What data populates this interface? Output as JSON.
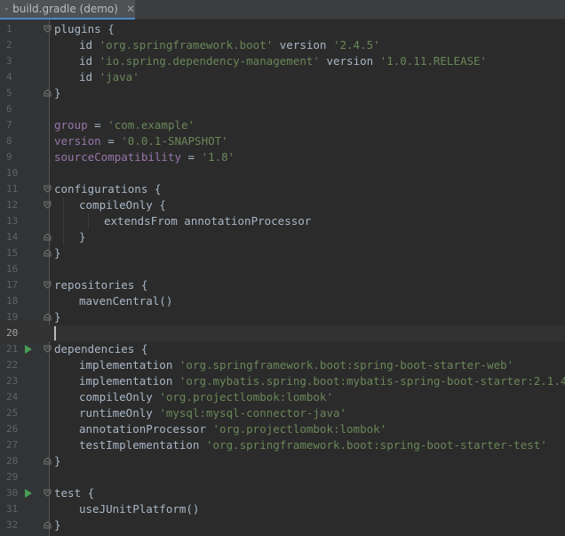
{
  "tab": {
    "title": "build.gradle (demo)",
    "close_glyph": "✕",
    "icon": "gradle-elephant-icon"
  },
  "editor": {
    "current_line": 20,
    "lines": [
      {
        "n": "1",
        "fold": "open",
        "run": false,
        "indent": 0,
        "tokens": [
          {
            "t": "plugins {",
            "c": "id"
          }
        ]
      },
      {
        "n": "2",
        "fold": "",
        "run": false,
        "indent": 1,
        "tokens": [
          {
            "t": "id ",
            "c": "id"
          },
          {
            "t": "'org.springframework.boot'",
            "c": "str"
          },
          {
            "t": " version ",
            "c": "id"
          },
          {
            "t": "'2.4.5'",
            "c": "str"
          }
        ]
      },
      {
        "n": "3",
        "fold": "",
        "run": false,
        "indent": 1,
        "tokens": [
          {
            "t": "id ",
            "c": "id"
          },
          {
            "t": "'io.spring.dependency-management'",
            "c": "str"
          },
          {
            "t": " version ",
            "c": "id"
          },
          {
            "t": "'1.0.11.RELEASE'",
            "c": "str"
          }
        ]
      },
      {
        "n": "4",
        "fold": "",
        "run": false,
        "indent": 1,
        "tokens": [
          {
            "t": "id ",
            "c": "id"
          },
          {
            "t": "'java'",
            "c": "str"
          }
        ]
      },
      {
        "n": "5",
        "fold": "close",
        "run": false,
        "indent": 0,
        "tokens": [
          {
            "t": "}",
            "c": "id"
          }
        ]
      },
      {
        "n": "6",
        "fold": "",
        "run": false,
        "indent": 0,
        "tokens": []
      },
      {
        "n": "7",
        "fold": "",
        "run": false,
        "indent": 0,
        "tokens": [
          {
            "t": "group",
            "c": "pr"
          },
          {
            "t": " = ",
            "c": "id"
          },
          {
            "t": "'com.example'",
            "c": "str"
          }
        ]
      },
      {
        "n": "8",
        "fold": "",
        "run": false,
        "indent": 0,
        "tokens": [
          {
            "t": "version",
            "c": "pr"
          },
          {
            "t": " = ",
            "c": "id"
          },
          {
            "t": "'0.0.1-SNAPSHOT'",
            "c": "str"
          }
        ]
      },
      {
        "n": "9",
        "fold": "",
        "run": false,
        "indent": 0,
        "tokens": [
          {
            "t": "sourceCompatibility",
            "c": "pr"
          },
          {
            "t": " = ",
            "c": "id"
          },
          {
            "t": "'1.8'",
            "c": "str"
          }
        ]
      },
      {
        "n": "10",
        "fold": "",
        "run": false,
        "indent": 0,
        "tokens": []
      },
      {
        "n": "11",
        "fold": "open",
        "run": false,
        "indent": 0,
        "tokens": [
          {
            "t": "configurations {",
            "c": "id"
          }
        ]
      },
      {
        "n": "12",
        "fold": "open",
        "run": false,
        "indent": 1,
        "tokens": [
          {
            "t": "compileOnly {",
            "c": "id"
          }
        ]
      },
      {
        "n": "13",
        "fold": "",
        "run": false,
        "indent": 2,
        "tokens": [
          {
            "t": "extendsFrom annotationProcessor",
            "c": "id"
          }
        ]
      },
      {
        "n": "14",
        "fold": "close",
        "run": false,
        "indent": 1,
        "tokens": [
          {
            "t": "}",
            "c": "id"
          }
        ]
      },
      {
        "n": "15",
        "fold": "close",
        "run": false,
        "indent": 0,
        "tokens": [
          {
            "t": "}",
            "c": "id"
          }
        ]
      },
      {
        "n": "16",
        "fold": "",
        "run": false,
        "indent": 0,
        "tokens": []
      },
      {
        "n": "17",
        "fold": "open",
        "run": false,
        "indent": 0,
        "tokens": [
          {
            "t": "repositories {",
            "c": "id"
          }
        ]
      },
      {
        "n": "18",
        "fold": "",
        "run": false,
        "indent": 1,
        "tokens": [
          {
            "t": "mavenCentral()",
            "c": "id"
          }
        ]
      },
      {
        "n": "19",
        "fold": "close",
        "run": false,
        "indent": 0,
        "tokens": [
          {
            "t": "}",
            "c": "id"
          }
        ]
      },
      {
        "n": "20",
        "fold": "",
        "run": false,
        "indent": 0,
        "tokens": []
      },
      {
        "n": "21",
        "fold": "open",
        "run": true,
        "indent": 0,
        "tokens": [
          {
            "t": "dependencies {",
            "c": "id"
          }
        ]
      },
      {
        "n": "22",
        "fold": "",
        "run": false,
        "indent": 1,
        "tokens": [
          {
            "t": "implementation ",
            "c": "id"
          },
          {
            "t": "'org.springframework.boot:spring-boot-starter-web'",
            "c": "str"
          }
        ]
      },
      {
        "n": "23",
        "fold": "",
        "run": false,
        "indent": 1,
        "tokens": [
          {
            "t": "implementation ",
            "c": "id"
          },
          {
            "t": "'org.mybatis.spring.boot:mybatis-spring-boot-starter:2.1.4'",
            "c": "str"
          }
        ]
      },
      {
        "n": "24",
        "fold": "",
        "run": false,
        "indent": 1,
        "tokens": [
          {
            "t": "compileOnly ",
            "c": "id"
          },
          {
            "t": "'org.projectlombok:lombok'",
            "c": "str"
          }
        ]
      },
      {
        "n": "25",
        "fold": "",
        "run": false,
        "indent": 1,
        "tokens": [
          {
            "t": "runtimeOnly ",
            "c": "id"
          },
          {
            "t": "'mysql:mysql-connector-java'",
            "c": "str"
          }
        ]
      },
      {
        "n": "26",
        "fold": "",
        "run": false,
        "indent": 1,
        "tokens": [
          {
            "t": "annotationProcessor ",
            "c": "id"
          },
          {
            "t": "'org.projectlombok:lombok'",
            "c": "str"
          }
        ]
      },
      {
        "n": "27",
        "fold": "",
        "run": false,
        "indent": 1,
        "tokens": [
          {
            "t": "testImplementation ",
            "c": "id"
          },
          {
            "t": "'org.springframework.boot:spring-boot-starter-test'",
            "c": "str"
          }
        ]
      },
      {
        "n": "28",
        "fold": "close",
        "run": false,
        "indent": 0,
        "tokens": [
          {
            "t": "}",
            "c": "id"
          }
        ]
      },
      {
        "n": "29",
        "fold": "",
        "run": false,
        "indent": 0,
        "tokens": []
      },
      {
        "n": "30",
        "fold": "open",
        "run": true,
        "indent": 0,
        "tokens": [
          {
            "t": "test {",
            "c": "id"
          }
        ]
      },
      {
        "n": "31",
        "fold": "",
        "run": false,
        "indent": 1,
        "tokens": [
          {
            "t": "useJUnitPlatform()",
            "c": "id"
          }
        ]
      },
      {
        "n": "32",
        "fold": "close",
        "run": false,
        "indent": 0,
        "tokens": [
          {
            "t": "}",
            "c": "id"
          }
        ]
      }
    ]
  },
  "colors": {
    "background": "#2b2b2b",
    "gutter": "#313335",
    "text": "#a9b7c6",
    "property": "#9876aa",
    "string": "#6a8759",
    "run_icon": "#499c54",
    "tab_underline": "#4a88c7"
  }
}
